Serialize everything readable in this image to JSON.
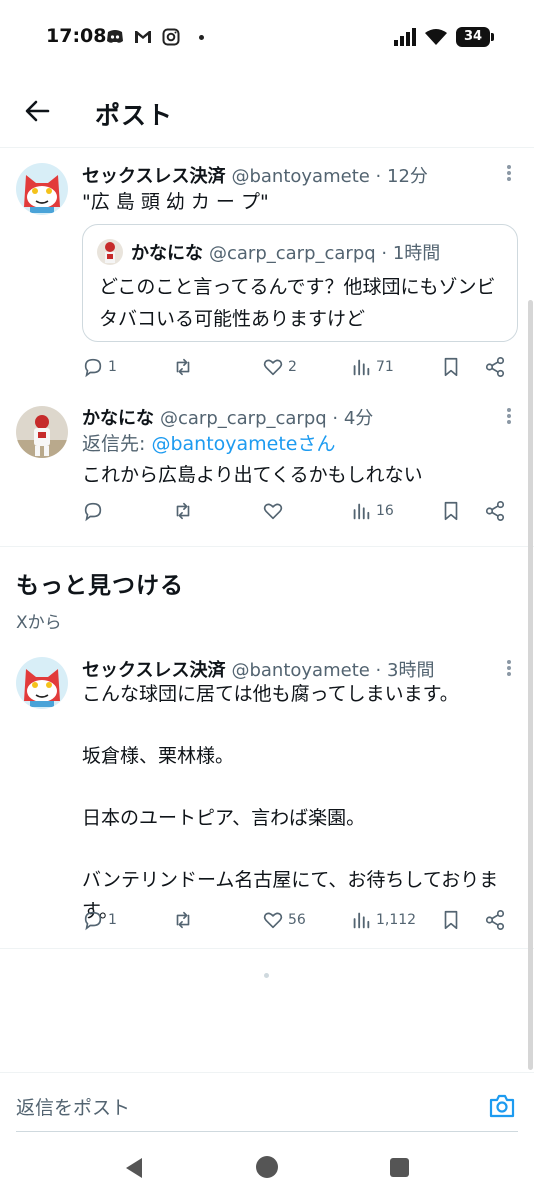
{
  "status_bar": {
    "time": "17:08",
    "battery": "34",
    "icons": [
      "discord-icon",
      "gmail-icon",
      "instagram-icon"
    ]
  },
  "header": {
    "title": "ポスト"
  },
  "tweets": [
    {
      "name": "セックスレス決済",
      "handle": "@bantoyamete · 12分",
      "text": "\"広 島 頭 幼 カ ー プ\"",
      "quote": {
        "name": "かなにな",
        "handle": "@carp_carp_carpq · 1時間",
        "text": "どこのこと言ってるんです？他球団にもゾンビタバコいる可能性ありますけど"
      },
      "actions": {
        "reply": "1",
        "retweet": "",
        "like": "2",
        "views": "71"
      }
    },
    {
      "name": "かなにな",
      "handle": "@carp_carp_carpq · 4分",
      "reply_prefix": "返信先: ",
      "reply_target": "@bantoyameteさん",
      "text": "これから広島より出てくるかもしれない",
      "actions": {
        "reply": "",
        "retweet": "",
        "like": "",
        "views": "16"
      }
    },
    {
      "name": "セックスレス決済",
      "handle": "@bantoyamete · 3時間",
      "lines": [
        "こんな球団に居ては他も腐ってしまいます。",
        "",
        "坂倉様、栗林様。",
        "",
        "日本のユートピア、言わば楽園。",
        "",
        "バンテリンドーム名古屋にて、お待ちしておりま",
        "す。"
      ],
      "actions": {
        "reply": "1",
        "retweet": "",
        "like": "56",
        "views": "1,112"
      }
    }
  ],
  "discover": {
    "title": "もっと見つける",
    "subtitle": "Xから"
  },
  "composer": {
    "placeholder": "返信をポスト"
  },
  "colors": {
    "accent": "#1d9bf0",
    "text": "#0f1419",
    "secondary": "#536471"
  }
}
